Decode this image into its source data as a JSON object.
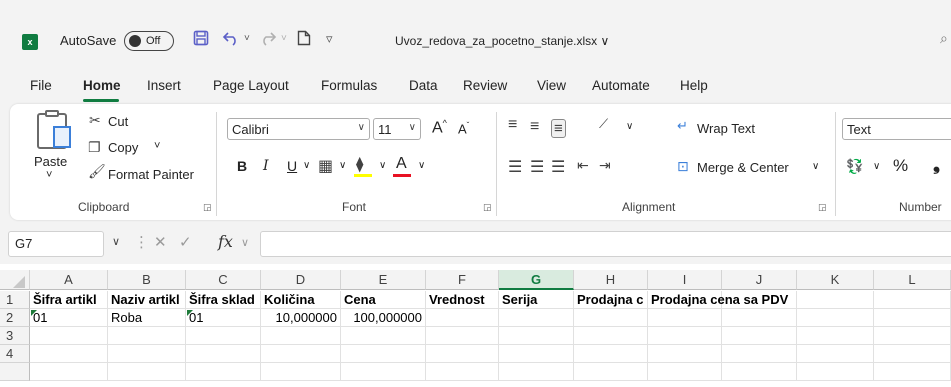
{
  "titlebar": {
    "app_icon": "excel-icon",
    "app_letter": "x",
    "autosave_label": "AutoSave",
    "autosave_state": "Off",
    "filename": "Uvoz_redova_za_pocetno_stanje.xlsx",
    "filename_chevron": "∨"
  },
  "tabs": [
    "File",
    "Home",
    "Insert",
    "Page Layout",
    "Formulas",
    "Data",
    "Review",
    "View",
    "Automate",
    "Help"
  ],
  "active_tab": "Home",
  "ribbon": {
    "clipboard": {
      "paste": "Paste",
      "paste_dd": "˅",
      "cut": "Cut",
      "copy": "Copy",
      "copy_dd": "˅",
      "format_painter": "Format Painter",
      "label": "Clipboard"
    },
    "font": {
      "family": "Calibri",
      "size": "11",
      "bold": "B",
      "italic": "I",
      "underline": "U",
      "grow": "A",
      "shrink": "A",
      "font_color_letter": "A",
      "highlight_color": "#ffff00",
      "font_color": "#e81123",
      "label": "Font"
    },
    "alignment": {
      "wrap_text": "Wrap Text",
      "merge_center": "Merge & Center",
      "label": "Alignment"
    },
    "number": {
      "format": "Text",
      "percent": "%",
      "label": "Number"
    }
  },
  "formula_bar": {
    "name_box": "G7",
    "fx": "fx",
    "value": ""
  },
  "grid": {
    "columns": [
      "A",
      "B",
      "C",
      "D",
      "E",
      "F",
      "G",
      "H",
      "I",
      "J",
      "K",
      "L"
    ],
    "selected_column": "G",
    "rows": [
      "1",
      "2",
      "3",
      "4"
    ],
    "row1": [
      "Šifra artikl",
      "Naziv artikl",
      "Šifra sklad",
      "Količina",
      "Cena",
      "Vrednost",
      "Serija",
      "Prodajna c",
      "Prodajna cena sa PDV",
      "",
      "",
      ""
    ],
    "row2": [
      "01",
      "Roba",
      "01",
      "10,000000",
      "100,000000",
      "",
      "",
      "",
      "",
      "",
      "",
      ""
    ]
  }
}
